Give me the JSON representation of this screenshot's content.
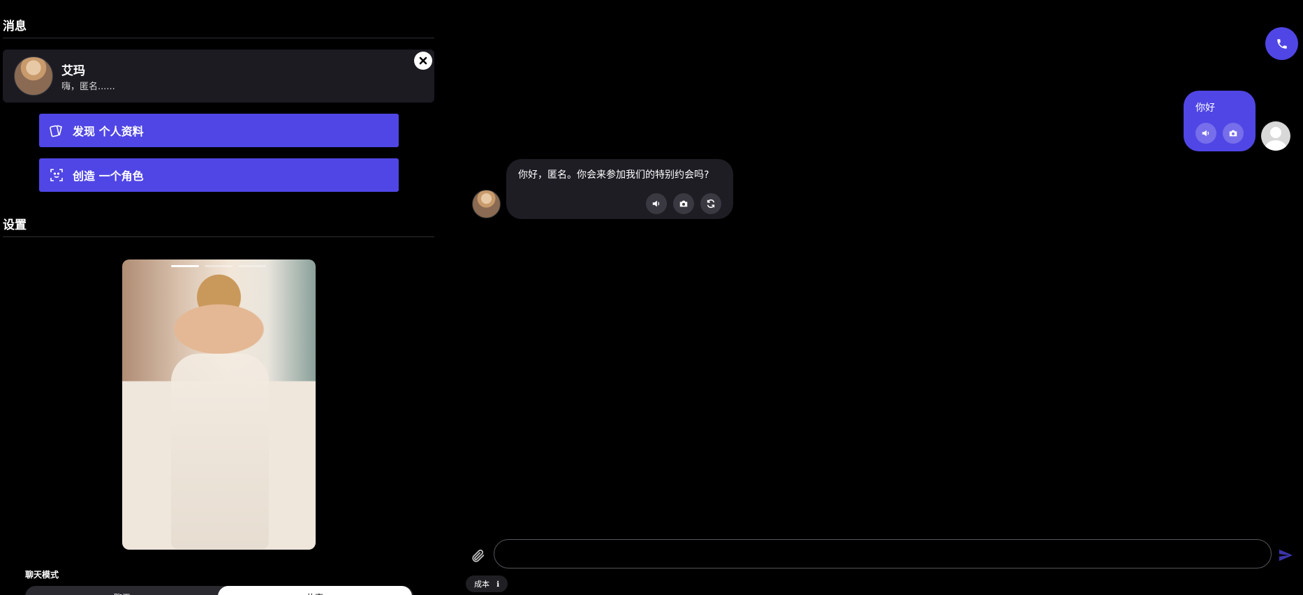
{
  "sidebar": {
    "messages_title": "消息",
    "conversation": {
      "name": "艾玛",
      "preview": "嗨，匿名......"
    },
    "actions": {
      "discover_label": "发现 个人资料",
      "create_label": "创造 一个角色"
    },
    "settings_title": "设置",
    "chat_mode": {
      "label": "聊天模式",
      "option_left": "聊天",
      "option_right": "故事"
    }
  },
  "chat": {
    "messages": [
      {
        "role": "user",
        "text": "你好"
      },
      {
        "role": "assistant",
        "text": "你好，匿名。你会来参加我们的特别约会吗?"
      }
    ],
    "input": {
      "value": "",
      "placeholder": ""
    },
    "cost_label": "成本",
    "cost_info_icon": "ℹ"
  },
  "colors": {
    "accent": "#5046e5",
    "background": "#000000",
    "card": "#1c1b22",
    "ai_bubble": "#1e1d24"
  },
  "icons": [
    "close-icon",
    "cards-icon",
    "scan-face-icon",
    "phone-icon",
    "speaker-icon",
    "camera-icon",
    "refresh-icon",
    "paperclip-icon",
    "send-icon",
    "info-icon"
  ]
}
